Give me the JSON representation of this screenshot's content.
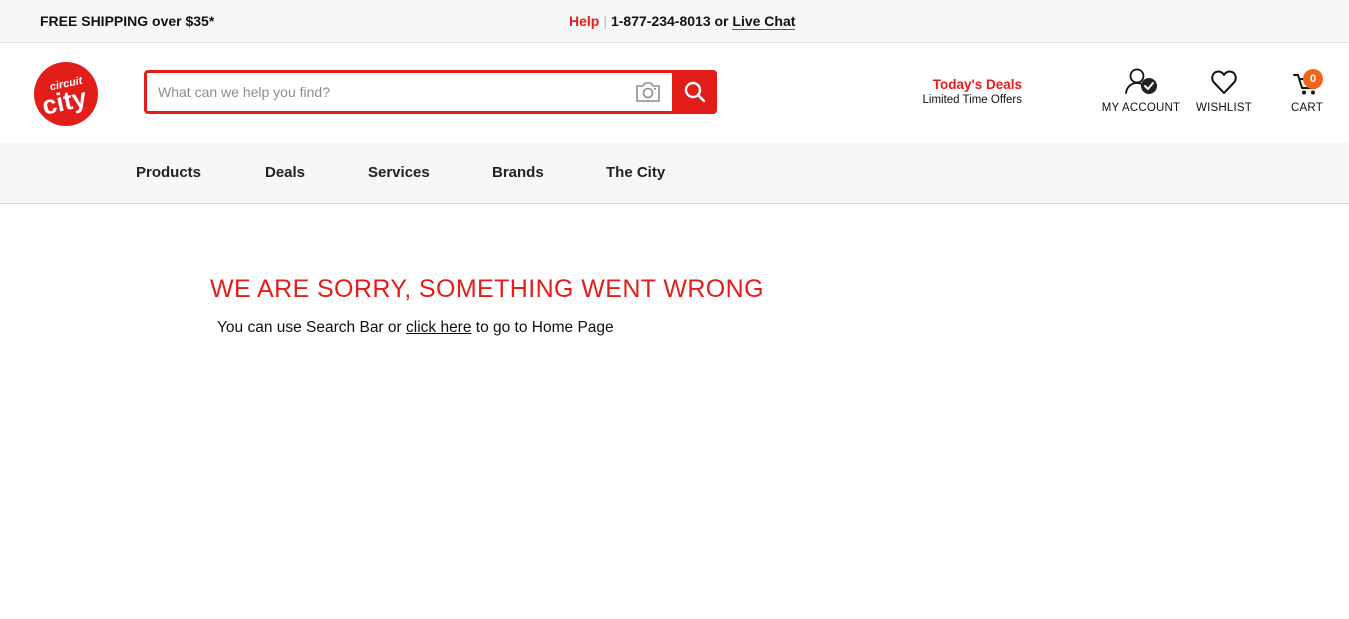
{
  "topbar": {
    "shipping": "FREE SHIPPING over $35*",
    "help": "Help",
    "separator": "|",
    "phone_text": "1-877-234-8013 or",
    "live_chat": "Live Chat"
  },
  "brand": {
    "logo_text_small": "circuit",
    "logo_text_big": "city",
    "color": "#e31d1a"
  },
  "search": {
    "placeholder": "What can we help you find?",
    "value": "",
    "camera_icon": "camera-icon",
    "submit_icon": "search-icon"
  },
  "deals": {
    "title": "Today's Deals",
    "subtitle": "Limited Time Offers"
  },
  "header_actions": {
    "account_label": "MY ACCOUNT",
    "wishlist_label": "WISHLIST",
    "cart_label": "CART",
    "cart_count": "0",
    "cart_badge_color": "#f26419"
  },
  "nav": {
    "items": [
      {
        "label": "Products"
      },
      {
        "label": "Deals"
      },
      {
        "label": "Services"
      },
      {
        "label": "Brands"
      },
      {
        "label": "The City"
      }
    ]
  },
  "error": {
    "title": "WE ARE SORRY, SOMETHING WENT WRONG",
    "text_before": "You can use Search Bar or ",
    "link": "click here",
    "text_after": " to go to Home Page"
  }
}
